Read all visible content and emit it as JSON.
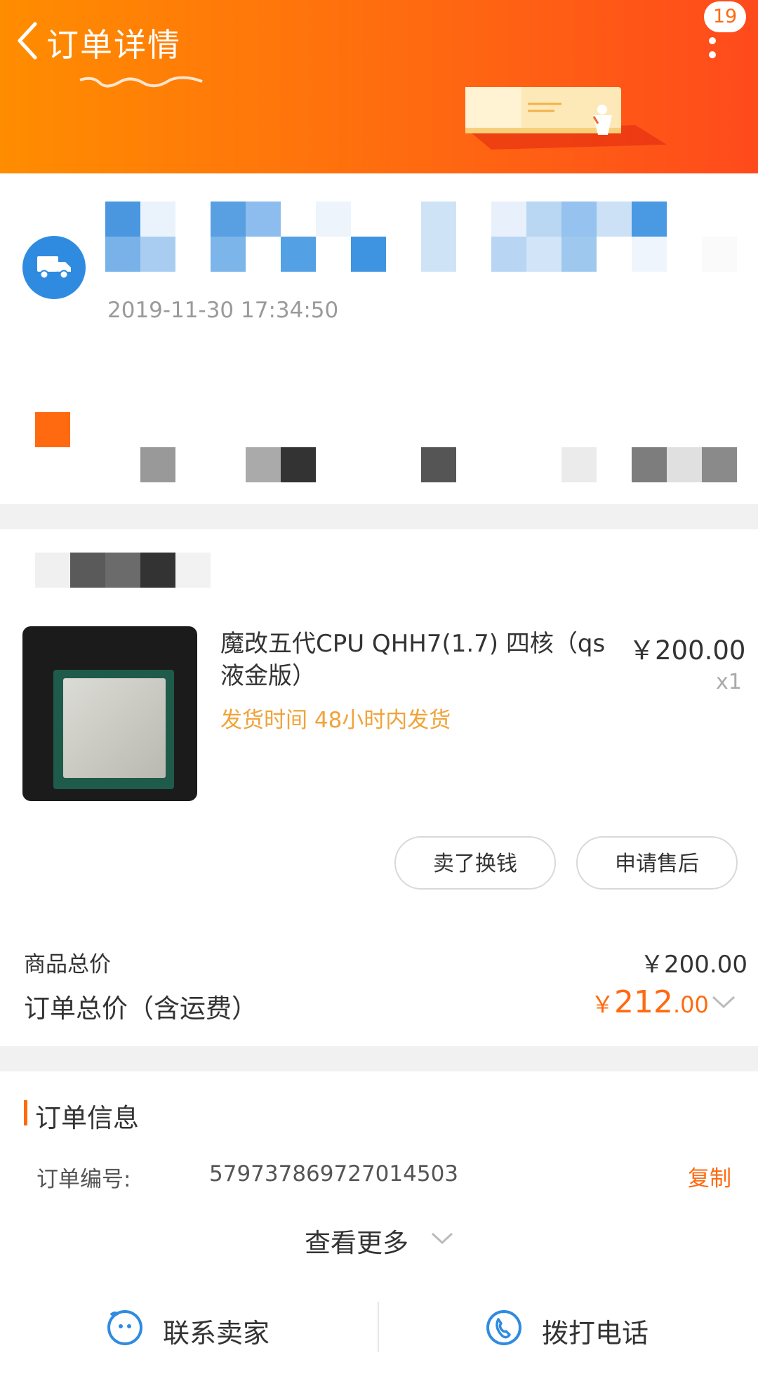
{
  "header": {
    "title": "订单详情",
    "notification_count": "19"
  },
  "status": {
    "timestamp": "2019-11-30 17:34:50"
  },
  "product": {
    "title": "魔改五代CPU QHH7(1.7) 四核（qs液金版）",
    "price": "￥200.00",
    "quantity": "x1",
    "shipping_time": "发货时间 48小时内发货"
  },
  "actions": {
    "sell": "卖了换钱",
    "after_sale": "申请售后"
  },
  "summary": {
    "goods_total_label": "商品总价",
    "goods_total_value": "￥200.00",
    "order_total_label": "订单总价（含运费）",
    "order_total_symbol": "￥",
    "order_total_integer": "212",
    "order_total_decimal": ".00"
  },
  "order_info": {
    "title": "订单信息",
    "order_no_label": "订单编号:",
    "order_no_value": "579737869727014503",
    "copy": "复制",
    "view_more": "查看更多"
  },
  "bottom_bar": {
    "contact_seller": "联系卖家",
    "call": "拨打电话"
  },
  "colors": {
    "accent": "#ff6a10",
    "truck_blue": "#2f8be0",
    "shipping_text": "#f0a33a"
  }
}
